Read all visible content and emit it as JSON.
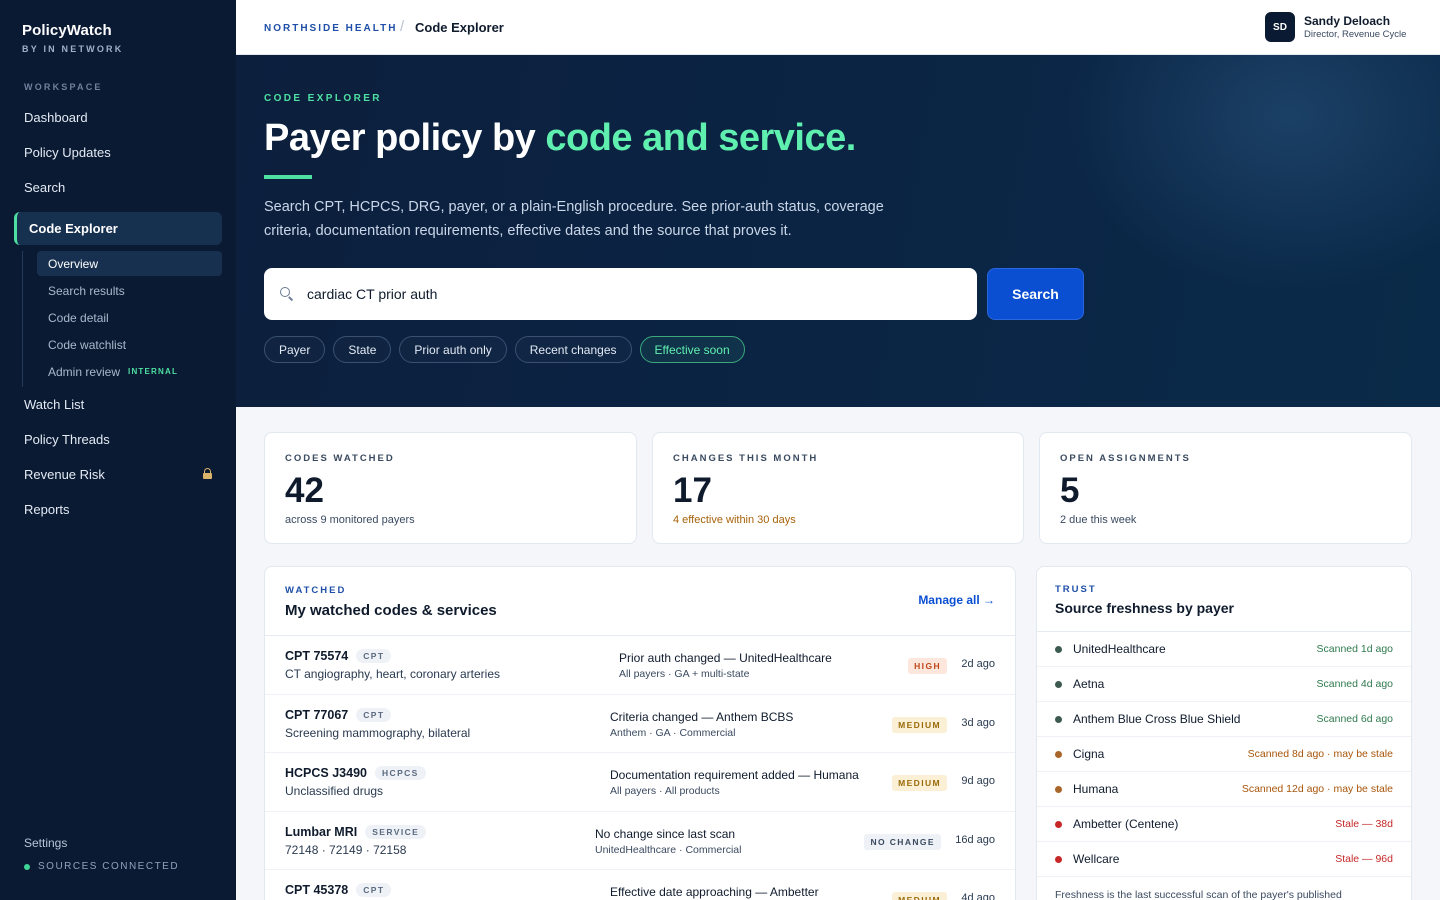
{
  "brand": {
    "name": "PolicyWatch",
    "sub": "BY IN NETWORK"
  },
  "sidebar": {
    "workspace_label": "WORKSPACE",
    "items_top": [
      "Dashboard",
      "Policy Updates",
      "Search"
    ],
    "active_item": "Code Explorer",
    "subitems": [
      "Overview",
      "Search results",
      "Code detail",
      "Code watchlist",
      "Admin review"
    ],
    "internal_badge": "INTERNAL",
    "items_bottom": [
      "Watch List",
      "Policy Threads",
      "Revenue Risk",
      "Reports"
    ],
    "settings": "Settings",
    "sources": "SOURCES CONNECTED"
  },
  "topbar": {
    "org": "NORTHSIDE HEALTH",
    "sep": "/",
    "page": "Code Explorer",
    "avatar": "SD",
    "user_name": "Sandy Deloach",
    "user_role": "Director, Revenue Cycle"
  },
  "hero": {
    "kicker": "CODE EXPLORER",
    "title_plain": "Payer policy by ",
    "title_accent": "code and service.",
    "description": "Search CPT, HCPCS, DRG, payer, or a plain-English procedure. See prior-auth status, coverage criteria, documentation requirements, effective dates and the source that proves it.",
    "search_value": "cardiac CT prior auth",
    "search_button": "Search",
    "chips": [
      "Payer",
      "State",
      "Prior auth only",
      "Recent changes",
      "Effective soon"
    ]
  },
  "stats": [
    {
      "label": "CODES WATCHED",
      "value": "42",
      "sub": "across 9 monitored payers"
    },
    {
      "label": "CHANGES THIS MONTH",
      "value": "17",
      "sub": "4 effective within 30 days"
    },
    {
      "label": "OPEN ASSIGNMENTS",
      "value": "5",
      "sub": "2 due this week"
    }
  ],
  "watched": {
    "kicker": "WATCHED",
    "title": "My watched codes & services",
    "manage": "Manage all →",
    "rows": [
      {
        "code": "CPT 75574",
        "type": "CPT",
        "desc": "CT angiography, heart, coronary arteries",
        "change": "Prior auth changed — UnitedHealthcare",
        "scope": "All payers · GA + multi-state",
        "sev": "HIGH",
        "ago": "2d ago"
      },
      {
        "code": "CPT 77067",
        "type": "CPT",
        "desc": "Screening mammography, bilateral",
        "change": "Criteria changed — Anthem BCBS",
        "scope": "Anthem · GA · Commercial",
        "sev": "MEDIUM",
        "ago": "3d ago"
      },
      {
        "code": "HCPCS J3490",
        "type": "HCPCS",
        "desc": "Unclassified drugs",
        "change": "Documentation requirement added — Humana",
        "scope": "All payers · All products",
        "sev": "MEDIUM",
        "ago": "9d ago"
      },
      {
        "code": "Lumbar MRI",
        "type": "SERVICE",
        "desc": "72148 · 72149 · 72158",
        "change": "No change since last scan",
        "scope": "UnitedHealthcare · Commercial",
        "sev": "NO CHANGE",
        "ago": "16d ago"
      },
      {
        "code": "CPT 45378",
        "type": "CPT",
        "desc": "",
        "change": "Effective date approaching — Ambetter",
        "scope": "",
        "sev": "MEDIUM",
        "ago": "4d ago"
      }
    ]
  },
  "freshness": {
    "kicker": "TRUST",
    "title": "Source freshness by payer",
    "rows": [
      {
        "payer": "UnitedHealthcare",
        "status": "Scanned 1d ago",
        "level": "ok"
      },
      {
        "payer": "Aetna",
        "status": "Scanned 4d ago",
        "level": "ok"
      },
      {
        "payer": "Anthem Blue Cross Blue Shield",
        "status": "Scanned 6d ago",
        "level": "ok"
      },
      {
        "payer": "Cigna",
        "status": "Scanned 8d ago · may be stale",
        "level": "warn"
      },
      {
        "payer": "Humana",
        "status": "Scanned 12d ago · may be stale",
        "level": "warn"
      },
      {
        "payer": "Ambetter (Centene)",
        "status": "Stale — 38d",
        "level": "stale"
      },
      {
        "payer": "Wellcare",
        "status": "Stale — 96d",
        "level": "stale"
      }
    ],
    "note": "Freshness is the last successful scan of the payer's published"
  },
  "colors": {
    "accent": "#4ee0a2",
    "brand_blue": "#0a4fd1",
    "navy": "#0b1a33",
    "ok": "#3d5a50",
    "warn": "#a8662a",
    "stale": "#c62828"
  }
}
